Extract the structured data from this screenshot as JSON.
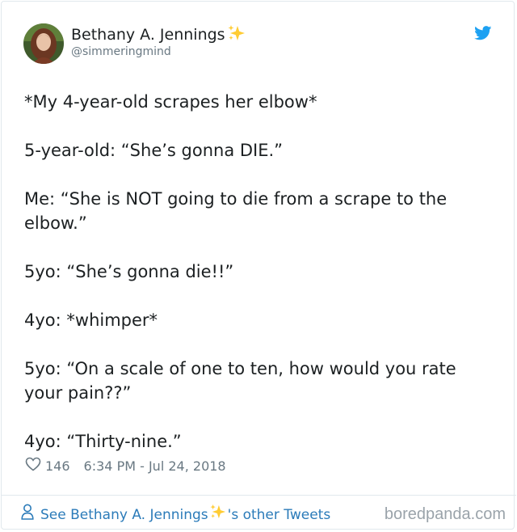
{
  "author": {
    "display_name": "Bethany A. Jennings",
    "handle": "@simmeringmind",
    "name_emoji": "sparkles"
  },
  "icons": {
    "platform": "twitter-bird-icon",
    "like": "heart-outline-icon",
    "profile": "person-icon",
    "twitter_blue": "#1da1f2",
    "sparkle_yellow": "#ffcc33"
  },
  "tweet": {
    "lines": [
      "*My 4-year-old scrapes her elbow*",
      "5-year-old: “She’s gonna DIE.”",
      "Me: “She is NOT going to die from a scrape to the elbow.”",
      "5yo: “She’s gonna die!!”",
      "4yo: *whimper*",
      "5yo: “On a scale of one to ten, how would you rate your pain??”",
      "4yo: “Thirty-nine.”"
    ]
  },
  "meta": {
    "like_count": "146",
    "timestamp": "6:34 PM - Jul 24, 2018"
  },
  "footer": {
    "link_prefix": "See Bethany A. Jennings",
    "link_suffix": "'s other Tweets",
    "watermark": "boredpanda.com"
  }
}
